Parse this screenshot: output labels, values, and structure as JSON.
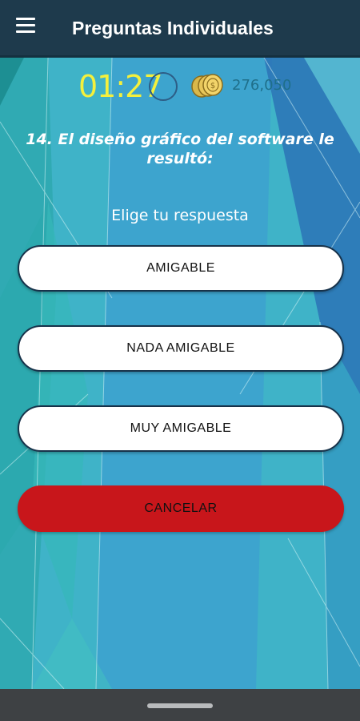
{
  "appbar": {
    "title": "Preguntas Individuales",
    "menu_icon": "hamburger-menu-icon"
  },
  "status": {
    "timer": "01:27",
    "coin_icon": "coins-icon",
    "score": "276,050"
  },
  "question": {
    "text": "14. El diseño gráfico del software le resultó:",
    "prompt": "Elige tu respuesta"
  },
  "answers": [
    {
      "label": "AMIGABLE"
    },
    {
      "label": "NADA AMIGABLE"
    },
    {
      "label": "MUY AMIGABLE"
    }
  ],
  "cancel_label": "CANCELAR",
  "colors": {
    "appbar": "#1e3a4c",
    "background": "#3fb3c8",
    "timer": "#f4f03c",
    "cancel": "#c8161b"
  }
}
